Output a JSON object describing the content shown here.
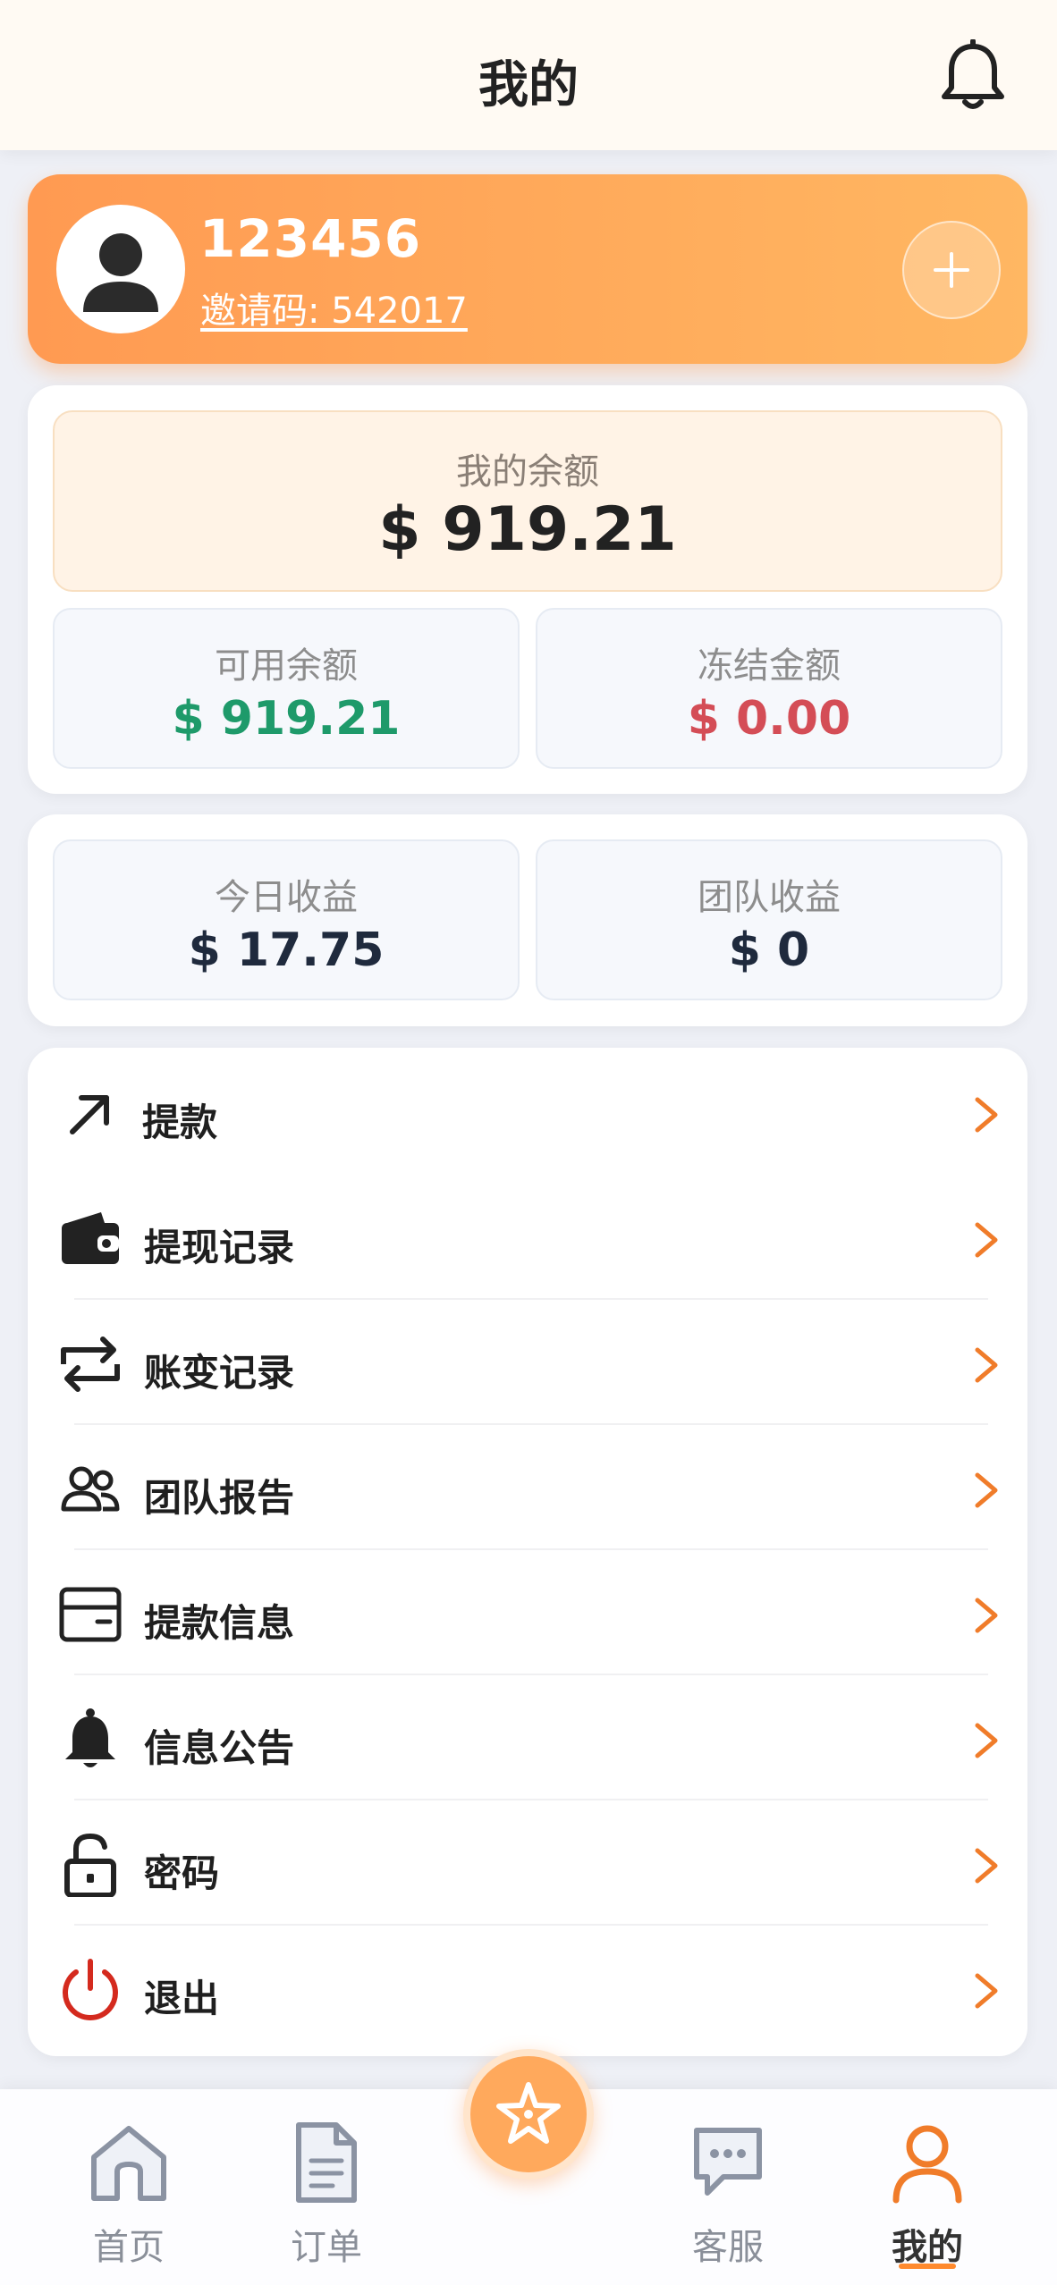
{
  "header": {
    "title": "我的"
  },
  "profile": {
    "username": "123456",
    "invite_code": "邀请码: 542017"
  },
  "balance": {
    "main_label": "我的余额",
    "main_value": "$ 919.21",
    "available_label": "可用余额",
    "available_value": "$ 919.21",
    "frozen_label": "冻结金额",
    "frozen_value": "$ 0.00"
  },
  "earnings": {
    "today_label": "今日收益",
    "today_value": "$ 17.75",
    "team_label": "团队收益",
    "team_value": "$ 0"
  },
  "menu": {
    "items": [
      {
        "label": "提款",
        "icon": "arrow-up-right-icon"
      },
      {
        "label": "提现记录",
        "icon": "wallet-icon"
      },
      {
        "label": "账变记录",
        "icon": "exchange-icon"
      },
      {
        "label": "团队报告",
        "icon": "users-icon"
      },
      {
        "label": "提款信息",
        "icon": "card-icon"
      },
      {
        "label": "信息公告",
        "icon": "bell-icon"
      },
      {
        "label": "密码",
        "icon": "lock-icon"
      },
      {
        "label": "退出",
        "icon": "power-icon"
      }
    ]
  },
  "nav": {
    "items": [
      {
        "label": "首页",
        "icon": "home-icon"
      },
      {
        "label": "订单",
        "icon": "document-icon"
      },
      {
        "label": "客服",
        "icon": "chat-icon"
      },
      {
        "label": "我的",
        "icon": "user-icon",
        "active": true
      }
    ]
  },
  "colors": {
    "accent": "#ff9a52",
    "green": "#1e9a6a",
    "red": "#d44d56"
  }
}
